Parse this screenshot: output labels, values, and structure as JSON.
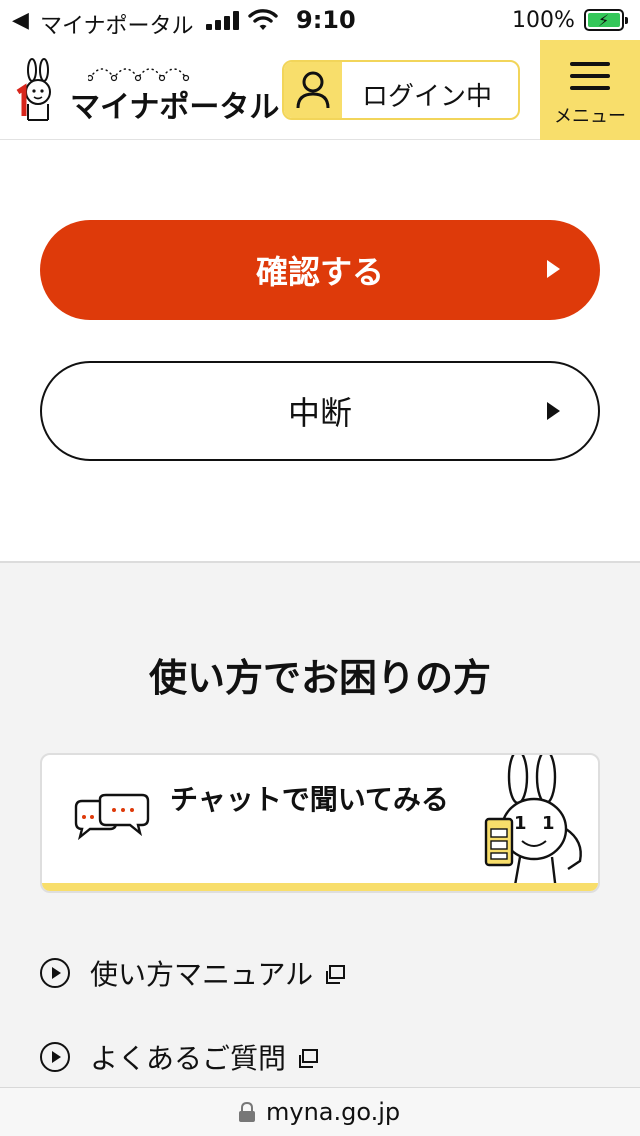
{
  "status_bar": {
    "back_label": "マイナポータル",
    "time": "9:10",
    "battery_percent": "100%"
  },
  "header": {
    "logo_text": "マイナポータル",
    "login_label": "ログイン中",
    "menu_label": "メニュー"
  },
  "actions": {
    "confirm_label": "確認する",
    "cancel_label": "中断"
  },
  "help": {
    "title": "使い方でお困りの方",
    "chat_label": "チャットで聞いてみる",
    "links": [
      {
        "label": "使い方マニュアル"
      },
      {
        "label": "よくあるご質問"
      }
    ]
  },
  "url_bar": {
    "url": "myna.go.jp"
  },
  "colors": {
    "primary": "#de3a0a",
    "accent_yellow": "#f8de6b",
    "help_background": "#f3f3f3"
  }
}
